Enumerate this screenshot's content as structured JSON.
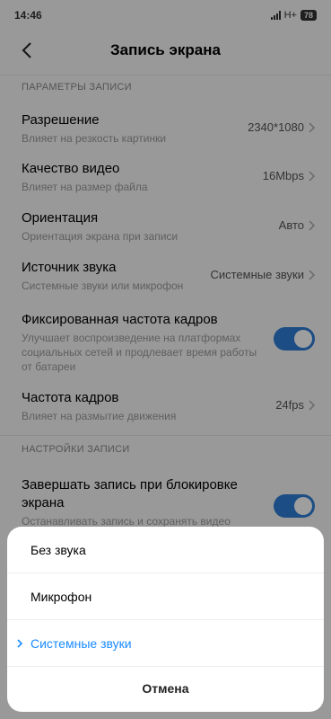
{
  "status_bar": {
    "time": "14:46",
    "network": "H+",
    "battery": "78"
  },
  "header": {
    "title": "Запись экрана"
  },
  "sections": {
    "record_params": "ПАРАМЕТРЫ ЗАПИСИ",
    "record_settings": "НАСТРОЙКИ ЗАПИСИ"
  },
  "settings": {
    "resolution": {
      "title": "Разрешение",
      "subtitle": "Влияет на резкость картинки",
      "value": "2340*1080"
    },
    "quality": {
      "title": "Качество видео",
      "subtitle": "Влияет на размер файла",
      "value": "16Mbps"
    },
    "orientation": {
      "title": "Ориентация",
      "subtitle": "Ориентация экрана при записи",
      "value": "Авто"
    },
    "sound_source": {
      "title": "Источник звука",
      "subtitle": "Системные звуки или микрофон",
      "value": "Системные звуки"
    },
    "fixed_fps": {
      "title": "Фиксированная частота кадров",
      "subtitle": "Улучшает воспроизведение на платформах социальных сетей и продлевает время работы от батареи",
      "enabled": true
    },
    "fps": {
      "title": "Частота кадров",
      "subtitle": "Влияет на размытие движения",
      "value": "24fps"
    },
    "stop_on_lock": {
      "title": "Завершать запись при блокировке экрана",
      "subtitle": "Останавливать запись и сохранять видео",
      "enabled": true
    }
  },
  "sheet": {
    "options": [
      "Без звука",
      "Микрофон",
      "Системные звуки"
    ],
    "selected_index": 2,
    "cancel_label": "Отмена"
  },
  "colors": {
    "accent": "#2e7dd6",
    "selected_text": "#1a8cff"
  }
}
